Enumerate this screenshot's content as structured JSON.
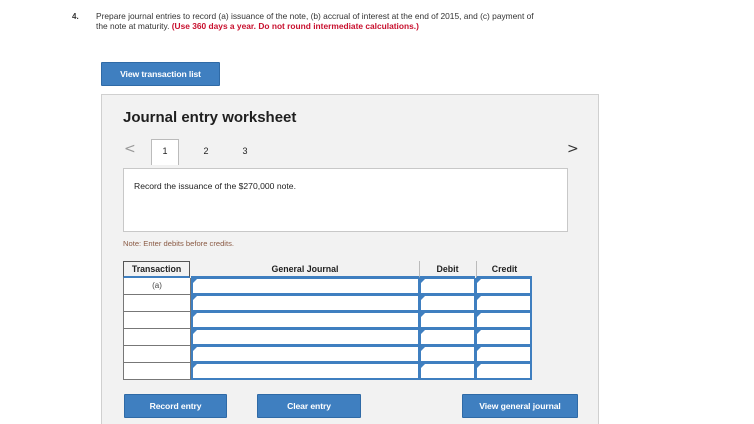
{
  "question": {
    "number": "4.",
    "text": "Prepare journal entries to record (a) issuance of the note, (b) accrual of interest at the end of 2015, and (c) payment of the note at maturity.",
    "instruction": "(Use 360 days a year. Do not round intermediate calculations.)"
  },
  "buttons": {
    "view_transaction_list": "View transaction list",
    "record_entry": "Record entry",
    "clear_entry": "Clear entry",
    "view_general_journal": "View general journal"
  },
  "worksheet": {
    "title": "Journal entry worksheet",
    "nav_prev": "<",
    "nav_next": ">",
    "pages": [
      "1",
      "2",
      "3"
    ],
    "active_page": "1",
    "description": "Record the issuance of the $270,000 note.",
    "note": "Note: Enter debits before credits."
  },
  "table": {
    "headers": {
      "transaction": "Transaction",
      "general_journal": "General Journal",
      "debit": "Debit",
      "credit": "Credit"
    },
    "rows": [
      {
        "transaction": "(a)",
        "account": "",
        "debit": "",
        "credit": ""
      },
      {
        "transaction": "",
        "account": "",
        "debit": "",
        "credit": ""
      },
      {
        "transaction": "",
        "account": "",
        "debit": "",
        "credit": ""
      },
      {
        "transaction": "",
        "account": "",
        "debit": "",
        "credit": ""
      },
      {
        "transaction": "",
        "account": "",
        "debit": "",
        "credit": ""
      },
      {
        "transaction": "",
        "account": "",
        "debit": "",
        "credit": ""
      }
    ]
  },
  "colors": {
    "accent": "#3f7fc0",
    "instruction_red": "#c8102e",
    "panel_bg": "#f2f2f2"
  }
}
